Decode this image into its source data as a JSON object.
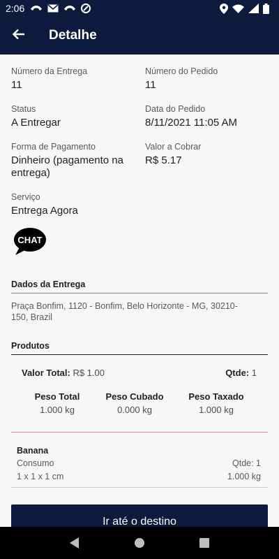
{
  "status_bar": {
    "time": "2:06"
  },
  "app_bar": {
    "title": "Detalhe"
  },
  "details": {
    "numero_entrega_label": "Número da Entrega",
    "numero_entrega_value": "11",
    "numero_pedido_label": "Número do Pedido",
    "numero_pedido_value": "11",
    "status_label": "Status",
    "status_value": "A Entregar",
    "data_pedido_label": "Data do Pedido",
    "data_pedido_value": "8/11/2021 11:05 AM",
    "forma_pagamento_label": "Forma de Pagamento",
    "forma_pagamento_value": "Dinheiro (pagamento na entrega)",
    "valor_cobrar_label": "Valor a Cobrar",
    "valor_cobrar_value": "R$ 5.17",
    "servico_label": "Serviço",
    "servico_value": "Entrega Agora"
  },
  "chat": {
    "label": "CHAT"
  },
  "dados_entrega": {
    "title": "Dados da Entrega",
    "address": "Praça Bonfim, 1120 - Bonfim, Belo Horizonte - MG, 30210-150, Brazil"
  },
  "produtos": {
    "title": "Produtos",
    "valor_total_label": "Valor Total:",
    "valor_total_value": "R$ 1.00",
    "qtde_label": "Qtde:",
    "qtde_value": "1",
    "peso_total_label": "Peso Total",
    "peso_total_value": "1.000 kg",
    "peso_cubado_label": "Peso Cubado",
    "peso_cubado_value": "0.000 kg",
    "peso_taxado_label": "Peso Taxado",
    "peso_taxado_value": "1.000 kg",
    "items": [
      {
        "name": "Banana",
        "category": "Consumo",
        "qtde": "Qtde: 1",
        "dimensions": "1 x 1 x 1 cm",
        "weight": "1.000 kg"
      }
    ]
  },
  "cta": {
    "label": "Ir até o destino"
  },
  "colors": {
    "primary": "#0c1a3d",
    "background": "#f7f6f8",
    "accent_red": "#e58c8c"
  },
  "icons": [
    "back-arrow-icon",
    "chat-bubble-icon",
    "location-icon",
    "wifi-icon",
    "signal-icon",
    "battery-icon",
    "nav-back-icon",
    "nav-home-icon",
    "nav-recents-icon"
  ]
}
